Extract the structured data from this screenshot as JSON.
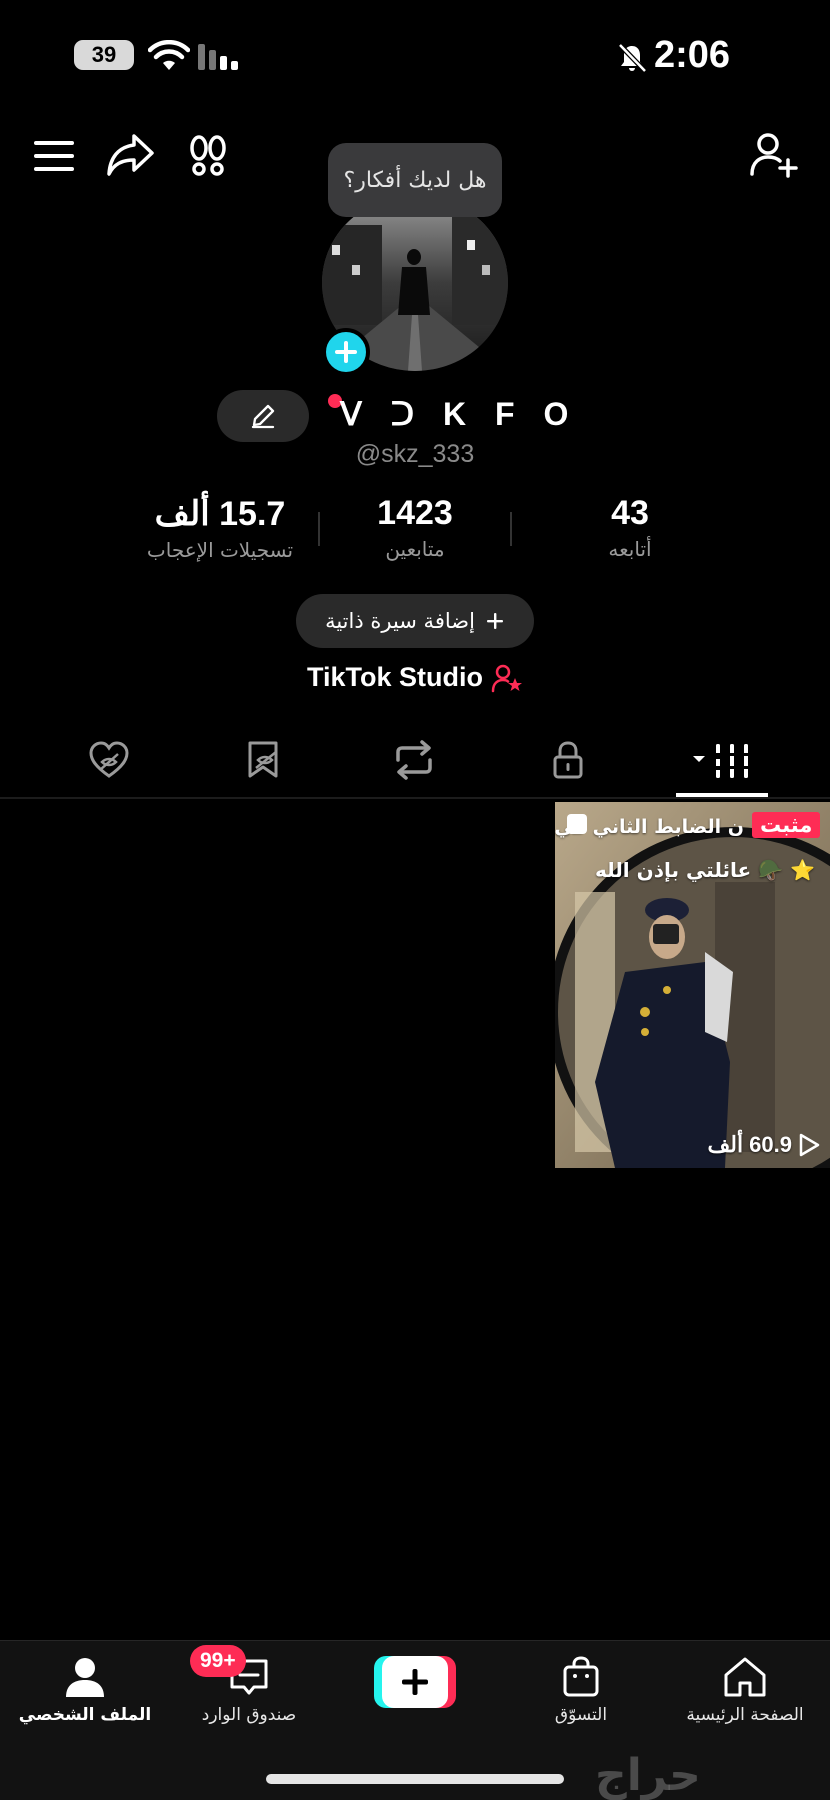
{
  "status_bar": {
    "battery": "39",
    "time": "2:06"
  },
  "header": {
    "menu_icon": "menu-icon",
    "share_icon": "share-arrow-icon",
    "footprints_icon": "footprints-icon",
    "add_friend_icon": "add-user-icon"
  },
  "profile": {
    "thought_bubble": "هل لديك أفكار؟",
    "display_name": "ᐯ ᑐ K F O",
    "username": "@skz_333",
    "stats": [
      {
        "value": "43",
        "label": "أتابعه"
      },
      {
        "value": "1423",
        "label": "متابعين"
      },
      {
        "value": "15.7 ألف",
        "label": "تسجيلات الإعجاب"
      }
    ],
    "add_bio": "إضافة سيرة ذاتية",
    "studio": "TikTok Studio"
  },
  "tabs": [
    {
      "name": "tab-videos",
      "icon": "grid-icon",
      "active": true
    },
    {
      "name": "tab-private",
      "icon": "lock-icon",
      "active": false
    },
    {
      "name": "tab-reposts",
      "icon": "repost-icon",
      "active": false
    },
    {
      "name": "tab-favorites",
      "icon": "bookmark-hidden-icon",
      "active": false
    },
    {
      "name": "tab-liked",
      "icon": "heart-hidden-icon",
      "active": false
    }
  ],
  "videos": [
    {
      "pinned_label": "مثبت",
      "caption_line1": "ن الضابط الثاني في",
      "caption_line2": "عائلتي بإذن الله",
      "views": "60.9 ألف"
    }
  ],
  "bottom_nav": {
    "home": "الصفحة الرئيسية",
    "shop": "التسوّق",
    "inbox": "صندوق الوارد",
    "inbox_badge": "99+",
    "profile": "الملف الشخصي"
  },
  "watermark": "حراج",
  "colors": {
    "accent_red": "#fe2c55",
    "accent_cyan": "#25f4ee",
    "badge_cyan": "#20d5ec"
  }
}
